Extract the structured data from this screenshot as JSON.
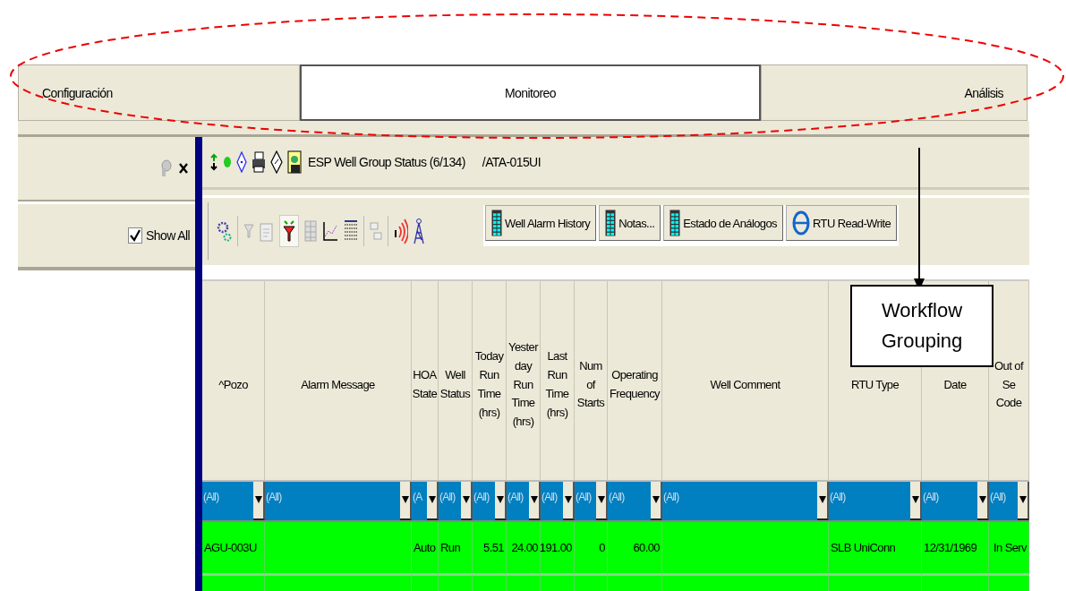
{
  "tabs": [
    {
      "label": "Configuración",
      "selected": false
    },
    {
      "label": "Monitoreo",
      "selected": true
    },
    {
      "label": "Análisis",
      "selected": false
    }
  ],
  "side_panel": {
    "show_all": {
      "label": "Show All",
      "checked": true
    }
  },
  "view": {
    "title": "ESP Well Group Status (6/134)",
    "path": "/ATA-015UI"
  },
  "report_buttons": [
    {
      "label": "Well Alarm History",
      "kind": "grid"
    },
    {
      "label": "Notas...",
      "kind": "grid"
    },
    {
      "label": "Estado de Análogos",
      "kind": "grid"
    },
    {
      "label": "RTU Read-Write",
      "kind": "web"
    }
  ],
  "grid": {
    "columns": [
      {
        "label": "^Pozo",
        "filter": "(All)",
        "kind": "text"
      },
      {
        "label": "Alarm Message",
        "filter": "(All)",
        "kind": "text"
      },
      {
        "label": "HOA State",
        "filter": "(A",
        "kind": "text"
      },
      {
        "label": "Well Status",
        "filter": "(All)",
        "kind": "text"
      },
      {
        "label": "Today Run Time (hrs)",
        "filter": "(All)",
        "kind": "number"
      },
      {
        "label": "Yester day Run Time (hrs)",
        "filter": "(All)",
        "kind": "number"
      },
      {
        "label": "Last Run Time (hrs)",
        "filter": "(All)",
        "kind": "number"
      },
      {
        "label": "Num of Starts",
        "filter": "(All)",
        "kind": "number"
      },
      {
        "label": "Operating Frequency",
        "filter": "(All)",
        "kind": "number"
      },
      {
        "label": "Well Comment",
        "filter": "(All)",
        "kind": "text"
      },
      {
        "label": "RTU Type",
        "filter": "(All)",
        "kind": "text"
      },
      {
        "label": "Date",
        "filter": "(All)",
        "kind": "text"
      },
      {
        "label": "Out of Se Code",
        "filter": "(All)",
        "kind": "number"
      }
    ],
    "rows": [
      {
        "cells": [
          "AGU-003U",
          null,
          "Auto",
          "Run",
          "5.51",
          "24.00",
          "191.00",
          "0",
          "60.00",
          null,
          "SLB UniConn",
          "12/31/1969",
          "In Serv"
        ]
      }
    ]
  },
  "annotation": {
    "callout": "Workflow Grouping"
  }
}
